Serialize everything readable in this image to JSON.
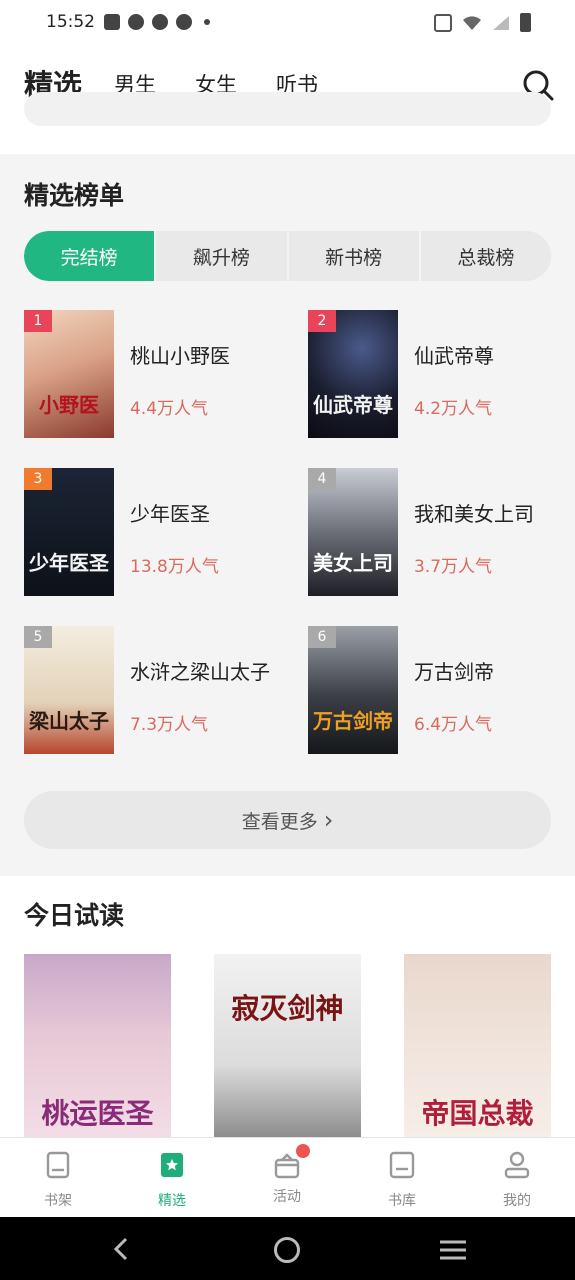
{
  "status_bar": {
    "time": "15:52"
  },
  "top_nav": {
    "tabs": [
      "精选",
      "男生",
      "女生",
      "听书"
    ],
    "active_tab": "精选",
    "accent_color": "#1bbf8a"
  },
  "ranking": {
    "title": "精选榜单",
    "segments": [
      "完结榜",
      "飙升榜",
      "新书榜",
      "总裁榜"
    ],
    "active_segment": "完结榜",
    "books": [
      {
        "rank": "1",
        "title": "桃山小野医",
        "popularity": "4.4万人气",
        "badge_color": "#e8455a",
        "cover_text": "小野医"
      },
      {
        "rank": "2",
        "title": "仙武帝尊",
        "popularity": "4.2万人气",
        "badge_color": "#e8455a",
        "cover_text": "仙武帝尊"
      },
      {
        "rank": "3",
        "title": "少年医圣",
        "popularity": "13.8万人气",
        "badge_color": "#f07a2e",
        "cover_text": "少年医圣"
      },
      {
        "rank": "4",
        "title": "我和美女上司",
        "popularity": "3.7万人气",
        "badge_color": "#a9a9a9",
        "cover_text": "美女上司"
      },
      {
        "rank": "5",
        "title": "水浒之梁山太子",
        "popularity": "7.3万人气",
        "badge_color": "#a9a9a9",
        "cover_text": "梁山太子"
      },
      {
        "rank": "6",
        "title": "万古剑帝",
        "popularity": "6.4万人气",
        "badge_color": "#a9a9a9",
        "cover_text": "万古剑帝"
      }
    ],
    "more_label": "查看更多",
    "more_arrow": "›"
  },
  "trial": {
    "title": "今日试读",
    "covers": [
      {
        "cover_text": "桃运医圣"
      },
      {
        "cover_text": "寂灭剑神"
      },
      {
        "cover_text": "帝国总裁"
      }
    ]
  },
  "bottom_nav": {
    "items": [
      "书架",
      "精选",
      "活动",
      "书库",
      "我的"
    ],
    "active": "精选"
  }
}
